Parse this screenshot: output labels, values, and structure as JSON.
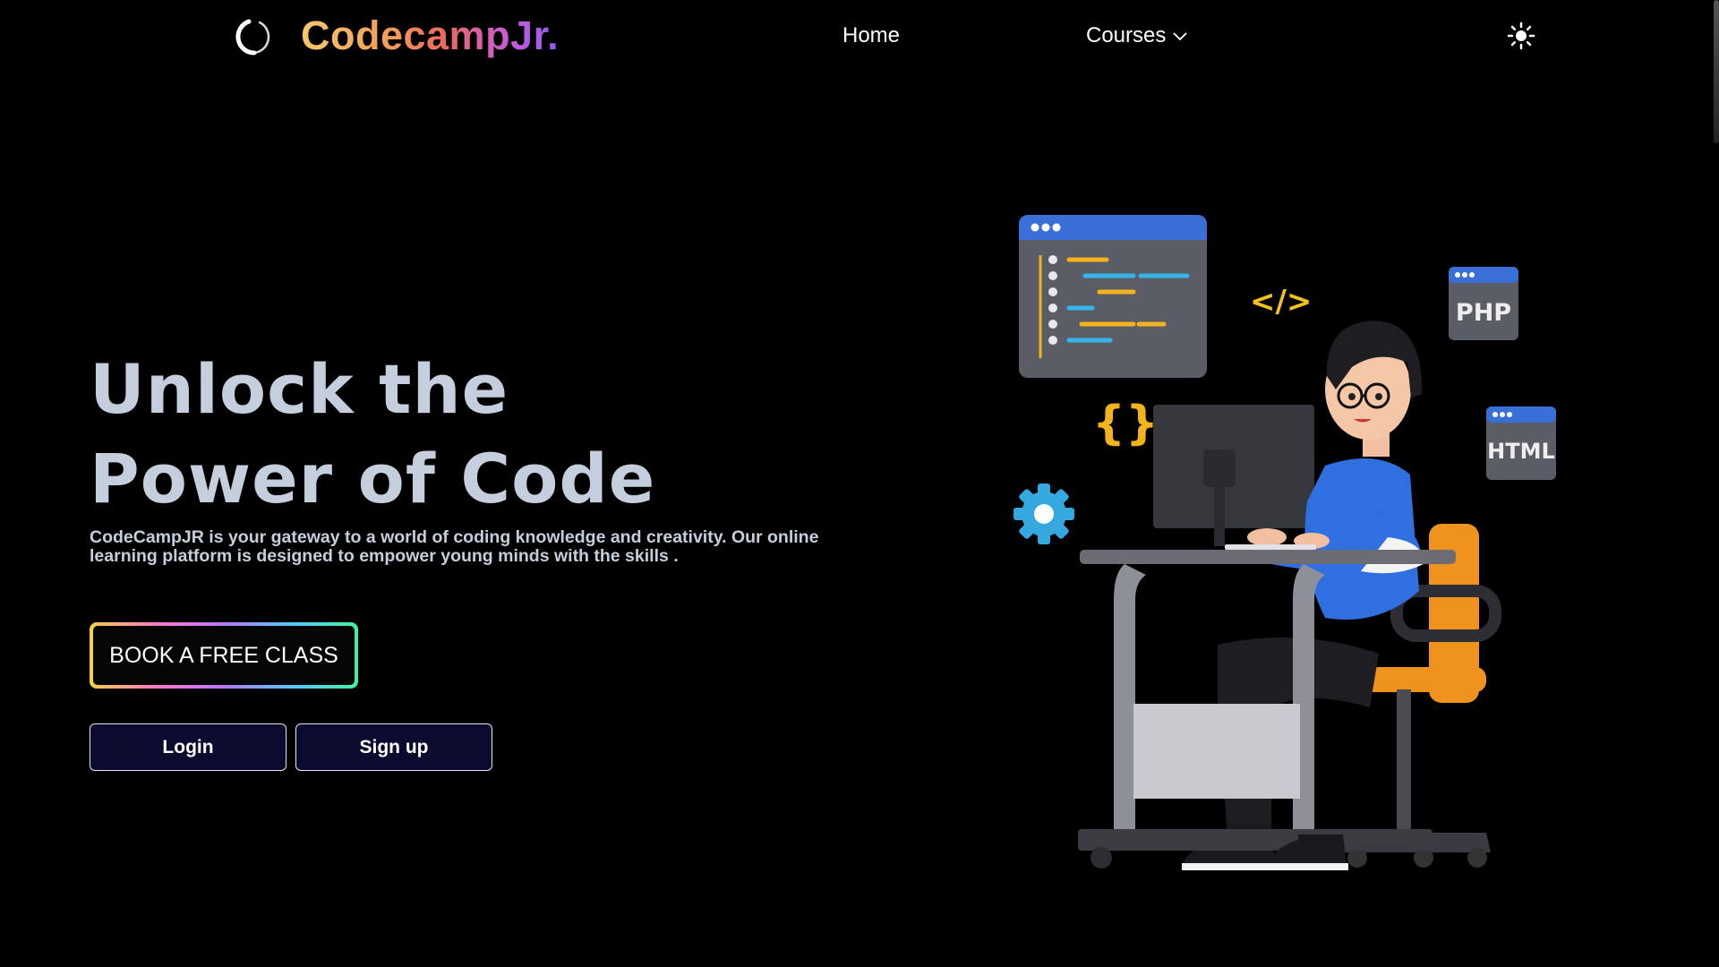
{
  "nav": {
    "brand": "CodecampJr.",
    "links": {
      "home": "Home",
      "courses": "Courses"
    }
  },
  "hero": {
    "title_line1": "Unlock the",
    "title_line2": "Power of Code",
    "description": "CodeCampJR is your gateway to a world of coding knowledge and creativity. Our online learning platform is designed to empower young minds with the skills .",
    "cta_label": "BOOK A FREE CLASS",
    "login_label": "Login",
    "signup_label": "Sign up"
  },
  "illustration": {
    "badges": {
      "php": "PHP",
      "html": "HTML",
      "tag": "</>",
      "braces": "{}"
    }
  },
  "colors": {
    "background": "#000000",
    "heading": "#c5cedd",
    "button_bg": "#0b0b30",
    "shirt": "#2f6fe0",
    "chair": "#f0921e",
    "window_header": "#3a6fd8"
  },
  "icons": [
    "logo-ring-icon",
    "chevron-down-icon",
    "sun-icon",
    "gear-icon"
  ]
}
